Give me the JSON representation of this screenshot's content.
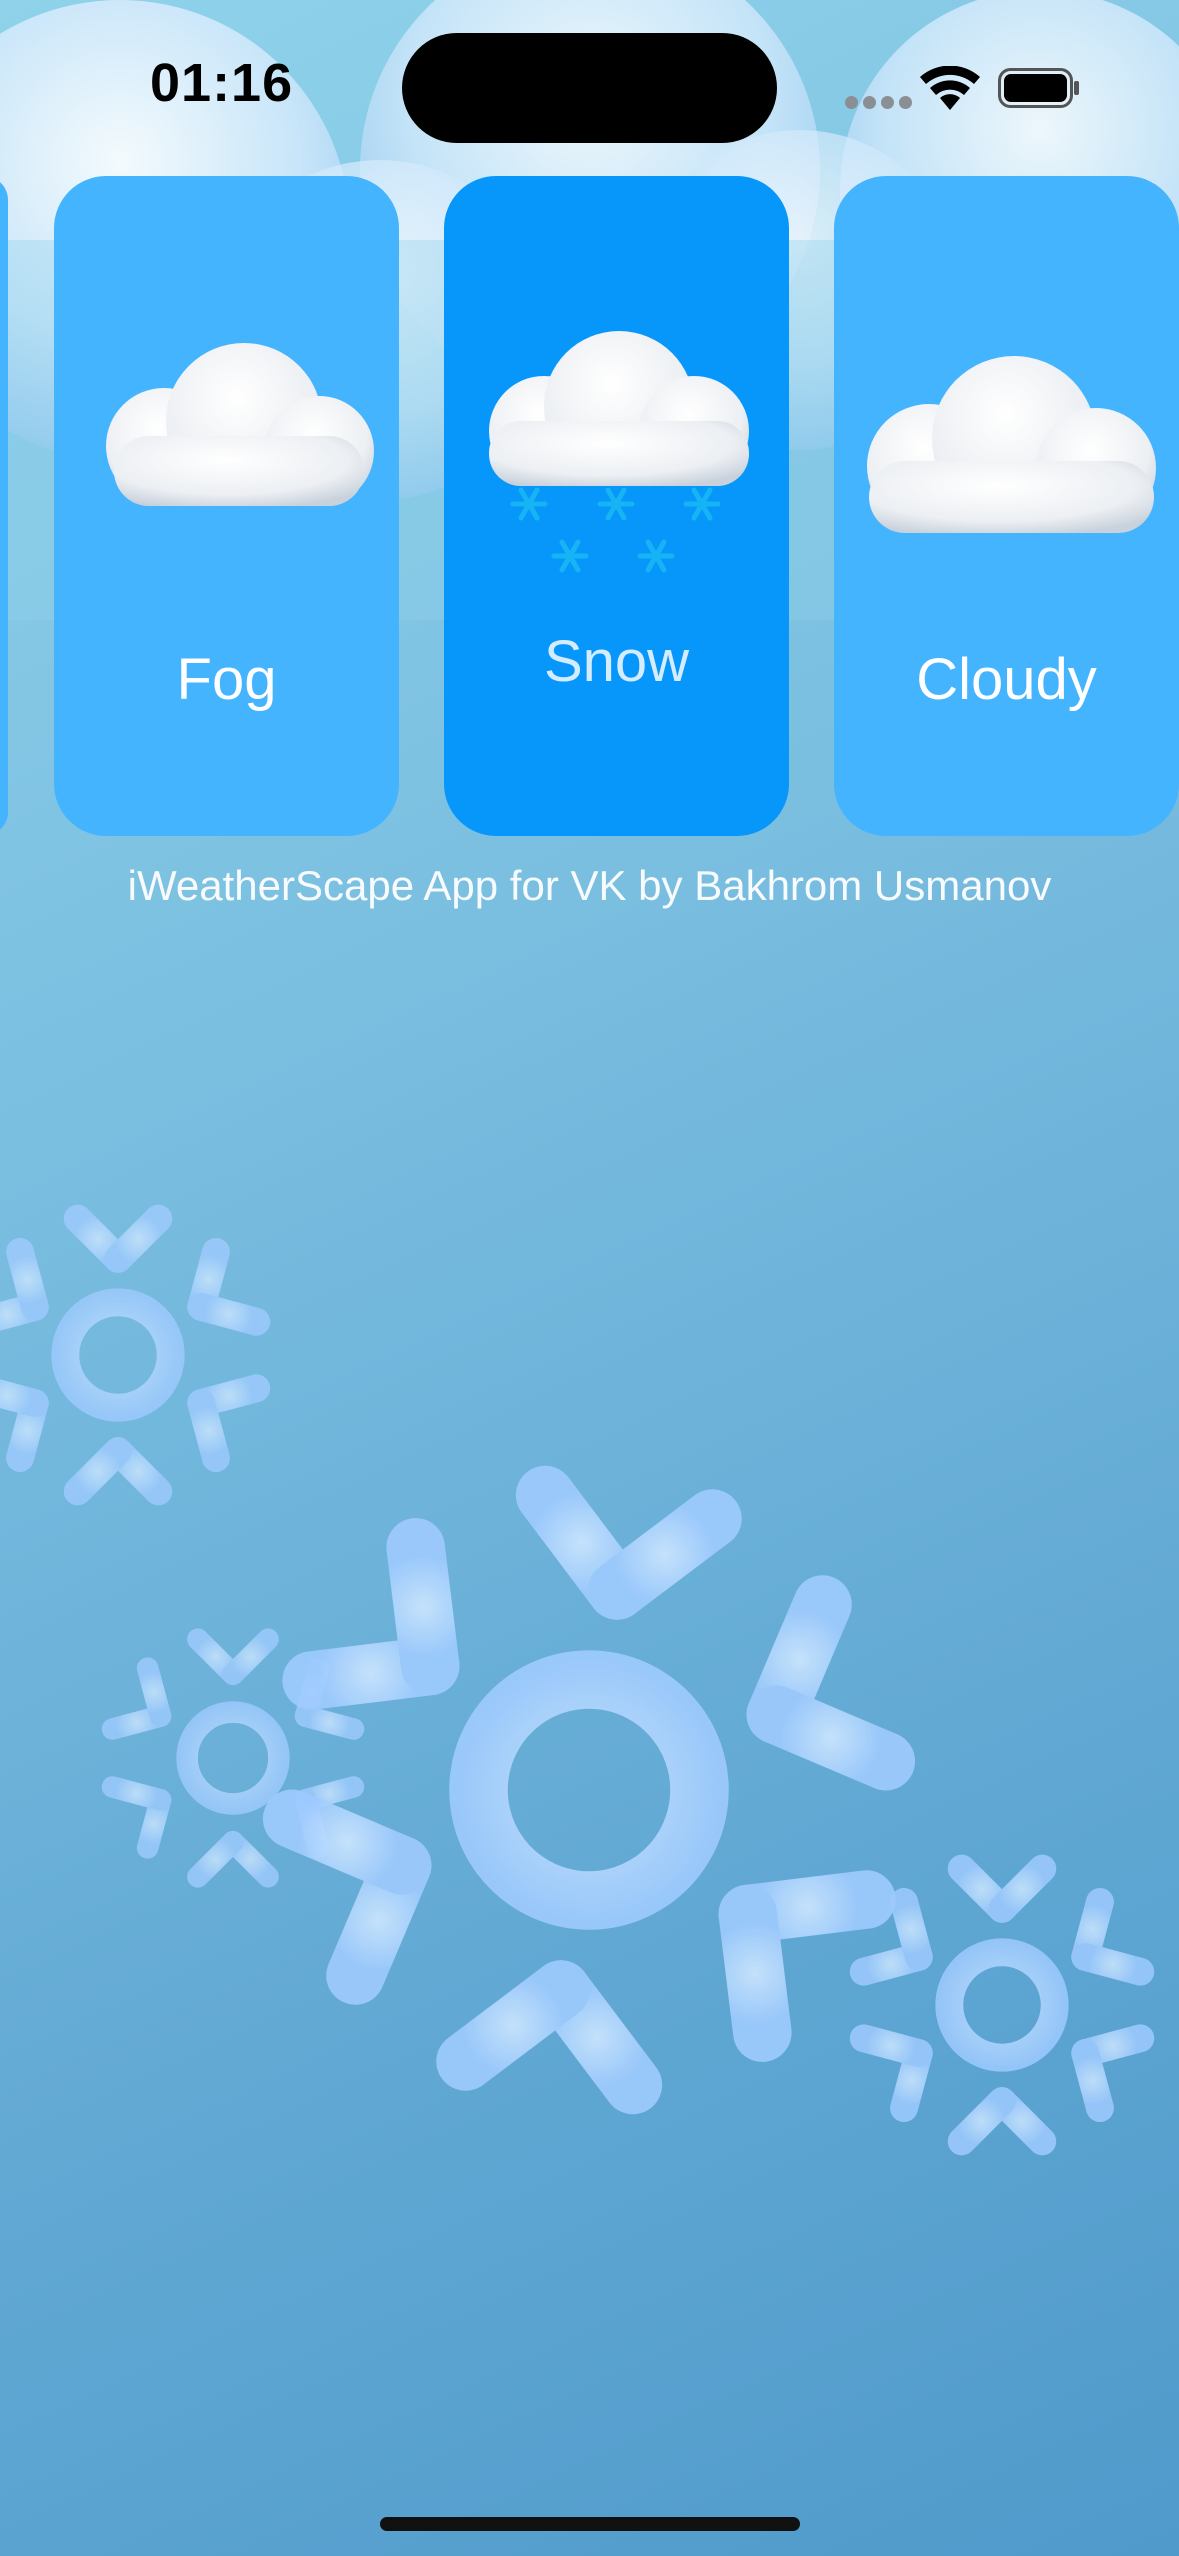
{
  "status_bar": {
    "time": "01:16"
  },
  "cards": [
    {
      "label": "Fog",
      "icon": "fog-cloud-icon",
      "selected": false
    },
    {
      "label": "Snow",
      "icon": "snow-cloud-icon",
      "selected": true
    },
    {
      "label": "Cloudy",
      "icon": "cloud-icon",
      "selected": false
    }
  ],
  "credit_text": "iWeatherScape App for VK by Bakhrom Usmanov",
  "colors": {
    "card": "#45b4ff",
    "card_selected": "#0797fb",
    "background": "#7cc0e1",
    "snowflake": "#a9d6ff"
  }
}
